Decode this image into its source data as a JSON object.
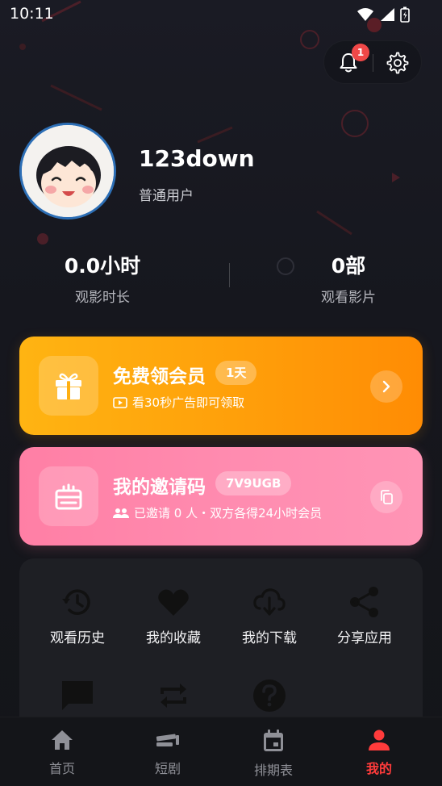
{
  "status_bar": {
    "time": "10:11"
  },
  "header": {
    "notification_count": "1"
  },
  "profile": {
    "username": "123down",
    "user_type": "普通用户"
  },
  "stats": [
    {
      "value": "0.0小时",
      "label": "观影时长"
    },
    {
      "value": "0部",
      "label": "观看影片"
    }
  ],
  "vip_card": {
    "title": "免费领会员",
    "tag": "1天",
    "subtitle": "看30秒广告即可领取",
    "color": "#ffa80c"
  },
  "invite_card": {
    "title": "我的邀请码",
    "code": "7V9UGB",
    "subtitle": "已邀请 0 人・双方各得24小时会员",
    "color": "#ff8cb0"
  },
  "grid": [
    {
      "label": "观看历史",
      "icon": "history-icon"
    },
    {
      "label": "我的收藏",
      "icon": "heart-icon"
    },
    {
      "label": "我的下载",
      "icon": "download-icon"
    },
    {
      "label": "分享应用",
      "icon": "share-icon"
    },
    {
      "label": "",
      "icon": "feedback-icon"
    },
    {
      "label": "",
      "icon": "repeat-icon"
    },
    {
      "label": "",
      "icon": "help-icon"
    }
  ],
  "bottom_nav": [
    {
      "label": "首页",
      "icon": "home-icon",
      "active": false
    },
    {
      "label": "短剧",
      "icon": "short-drama-icon",
      "active": false
    },
    {
      "label": "排期表",
      "icon": "calendar-icon",
      "active": false
    },
    {
      "label": "我的",
      "icon": "profile-icon",
      "active": true
    }
  ],
  "colors": {
    "accent": "#ff3b3b",
    "background": "#15161c",
    "avatar_ring": "#2d6fb6"
  }
}
